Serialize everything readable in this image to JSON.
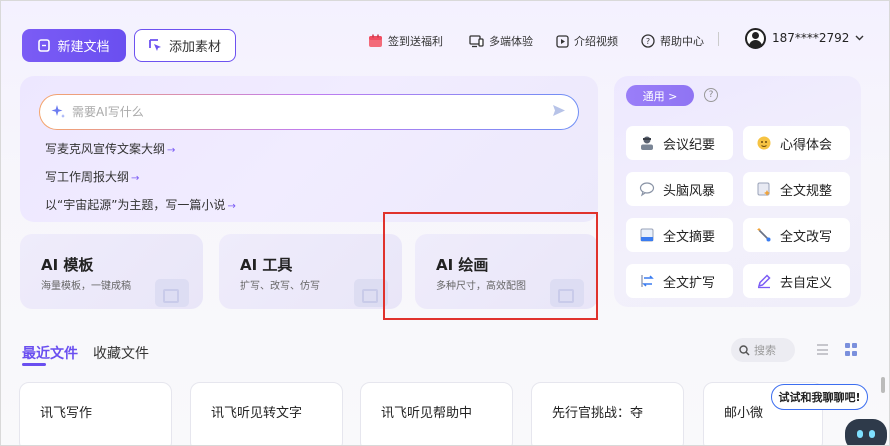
{
  "header": {
    "new_doc": "新建文档",
    "add_material": "添加素材",
    "nav": [
      {
        "label": "签到送福利",
        "icon": "gift-calendar-icon"
      },
      {
        "label": "多端体验",
        "icon": "devices-icon"
      },
      {
        "label": "介绍视频",
        "icon": "video-play-icon"
      },
      {
        "label": "帮助中心",
        "icon": "help-circle-icon"
      }
    ],
    "user_phone": "187****2792"
  },
  "ai_panel": {
    "placeholder": "需要AI写什么",
    "suggestions": [
      "写麦克风宣传文案大纲",
      "写工作周报大纲",
      "以“宇宙起源”为主题，写一篇小说"
    ]
  },
  "cards": [
    {
      "title": "AI 模板",
      "sub": "海量模板，一键成稿"
    },
    {
      "title": "AI 工具",
      "sub": "扩写、改写、仿写"
    },
    {
      "title": "AI 绘画",
      "sub": "多种尺寸，高效配图"
    }
  ],
  "right_panel": {
    "tag": "通用 >",
    "tools": [
      {
        "label": "会议纪要",
        "icon": "meeting-person-icon"
      },
      {
        "label": "心得体会",
        "icon": "emoji-face-icon"
      },
      {
        "label": "头脑风暴",
        "icon": "speech-bubble-icon"
      },
      {
        "label": "全文规整",
        "icon": "sparkle-doc-icon"
      },
      {
        "label": "全文摘要",
        "icon": "summary-doc-icon"
      },
      {
        "label": "全文改写",
        "icon": "magic-wand-icon"
      },
      {
        "label": "全文扩写",
        "icon": "expand-arrows-icon"
      },
      {
        "label": "去自定义",
        "icon": "pencil-icon"
      }
    ]
  },
  "files": {
    "tab_recent": "最近文件",
    "tab_fav": "收藏文件",
    "search_placeholder": "搜索",
    "items": [
      "讯飞写作",
      "讯飞听见转文字",
      "讯飞听见帮助中",
      "先行官挑战：夺",
      "邮小微"
    ]
  },
  "chat": {
    "label": "试试和我聊聊吧!"
  },
  "colors": {
    "accent": "#6a4ff0",
    "highlight": "#e0322c"
  }
}
